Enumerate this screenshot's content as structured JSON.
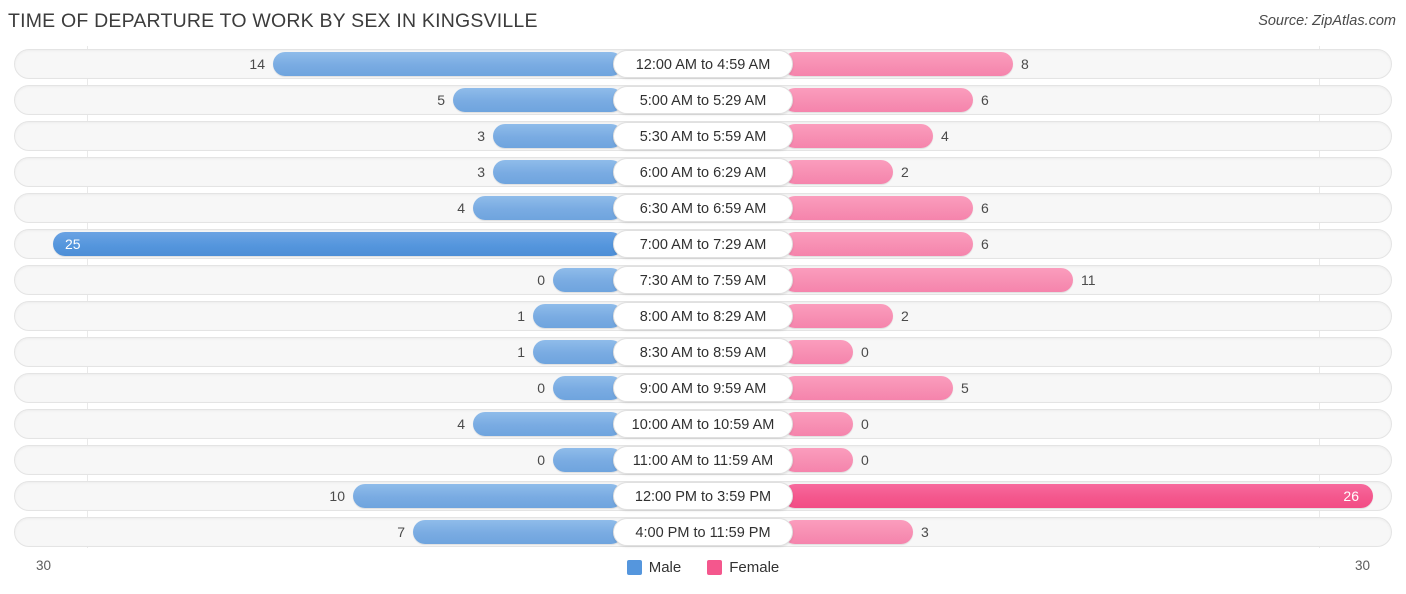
{
  "header": {
    "title": "TIME OF DEPARTURE TO WORK BY SEX IN KINGSVILLE",
    "source": "Source: ZipAtlas.com"
  },
  "axis": {
    "left_label": "30",
    "right_label": "30"
  },
  "legend": {
    "items": [
      {
        "label": "Male",
        "color": "#5596dd"
      },
      {
        "label": "Female",
        "color": "#f4578d"
      }
    ]
  },
  "colors": {
    "male": "#7cafe4",
    "male_highlight": "#5596dd",
    "female": "#f78fb3",
    "female_highlight": "#f4578d",
    "track": "#f7f7f7",
    "track_border": "#e4e4e4",
    "text": "#3a3a3a"
  },
  "chart_data": {
    "type": "bar",
    "title": "TIME OF DEPARTURE TO WORK BY SEX IN KINGSVILLE",
    "subtitle": "",
    "orientation": "horizontal-diverging",
    "xlabel": "",
    "ylabel": "",
    "xlim": [
      30,
      30
    ],
    "grid": false,
    "legend_position": "bottom-center",
    "categories": [
      "12:00 AM to 4:59 AM",
      "5:00 AM to 5:29 AM",
      "5:30 AM to 5:59 AM",
      "6:00 AM to 6:29 AM",
      "6:30 AM to 6:59 AM",
      "7:00 AM to 7:29 AM",
      "7:30 AM to 7:59 AM",
      "8:00 AM to 8:29 AM",
      "8:30 AM to 8:59 AM",
      "9:00 AM to 9:59 AM",
      "10:00 AM to 10:59 AM",
      "11:00 AM to 11:59 AM",
      "12:00 PM to 3:59 PM",
      "4:00 PM to 11:59 PM"
    ],
    "series": [
      {
        "name": "Male",
        "color": "#7cafe4",
        "direction": "left",
        "values": [
          14,
          5,
          3,
          3,
          4,
          25,
          0,
          1,
          1,
          0,
          4,
          0,
          10,
          7
        ]
      },
      {
        "name": "Female",
        "color": "#f78fb3",
        "direction": "right",
        "values": [
          8,
          6,
          4,
          2,
          6,
          6,
          11,
          2,
          0,
          5,
          0,
          0,
          26,
          3
        ]
      }
    ]
  },
  "rows": [
    {
      "category": "12:00 AM to 4:59 AM",
      "male": "14",
      "female": "8"
    },
    {
      "category": "5:00 AM to 5:29 AM",
      "male": "5",
      "female": "6"
    },
    {
      "category": "5:30 AM to 5:59 AM",
      "male": "3",
      "female": "4"
    },
    {
      "category": "6:00 AM to 6:29 AM",
      "male": "3",
      "female": "2"
    },
    {
      "category": "6:30 AM to 6:59 AM",
      "male": "4",
      "female": "6"
    },
    {
      "category": "7:00 AM to 7:29 AM",
      "male": "25",
      "female": "6"
    },
    {
      "category": "7:30 AM to 7:59 AM",
      "male": "0",
      "female": "11"
    },
    {
      "category": "8:00 AM to 8:29 AM",
      "male": "1",
      "female": "2"
    },
    {
      "category": "8:30 AM to 8:59 AM",
      "male": "1",
      "female": "0"
    },
    {
      "category": "9:00 AM to 9:59 AM",
      "male": "0",
      "female": "5"
    },
    {
      "category": "10:00 AM to 10:59 AM",
      "male": "4",
      "female": "0"
    },
    {
      "category": "11:00 AM to 11:59 AM",
      "male": "0",
      "female": "0"
    },
    {
      "category": "12:00 PM to 3:59 PM",
      "male": "10",
      "female": "26"
    },
    {
      "category": "4:00 PM to 11:59 PM",
      "male": "7",
      "female": "3"
    }
  ]
}
